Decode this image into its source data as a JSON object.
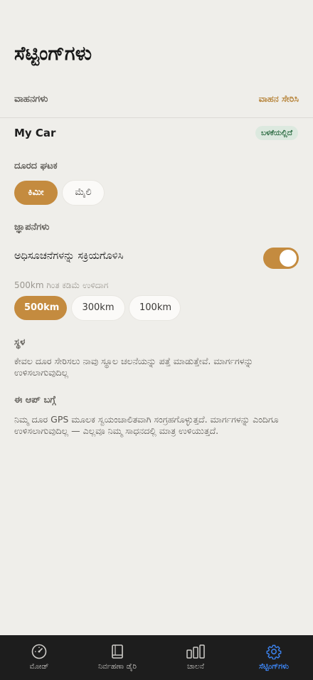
{
  "header": {
    "title": "ಸೆಟ್ಟಿಂಗ್‌ಗಳು"
  },
  "vehicles": {
    "label": "ವಾಹನಗಳು",
    "add_label": "ವಾಹನ ಸೇರಿಸಿ",
    "items": [
      {
        "name": "My Car",
        "badge": "ಬಳಕೆಯಲ್ಲಿದೆ"
      }
    ]
  },
  "distance_unit": {
    "label": "ದೂರದ ಘಟಕ",
    "options": [
      {
        "label": "ಕಿಮೀ",
        "selected": true
      },
      {
        "label": "ಮೈಲಿ",
        "selected": false
      }
    ]
  },
  "reminders": {
    "label": "ಜ್ಞಾಪನೆಗಳು",
    "notifications_label": "ಅಧಿಸೂಚನೆಗಳನ್ನು ಸಕ್ರಿಯಗೊಳಿಸಿ",
    "notifications_enabled": true,
    "threshold_label": "500km ಗಿಂತ ಕಡಿಮೆ ಉಳಿದಾಗ",
    "thresholds": [
      {
        "label": "500km",
        "selected": true
      },
      {
        "label": "300km",
        "selected": false
      },
      {
        "label": "100km",
        "selected": false
      }
    ]
  },
  "location": {
    "label": "ಸ್ಥಳ",
    "description": "ಕೇವಲ ದೂರ ಸೇರಿಸಲು ನಾವು ಸ್ಥೂಲ ಚಲನೆಯನ್ನು ಪತ್ತೆ ಮಾಡುತ್ತೇವೆ. ಮಾರ್ಗಗಳನ್ನು ಉಳಿಸಲಾಗುವುದಿಲ್ಲ"
  },
  "about": {
    "label": "ಈ ಆಪ್ ಬಗ್ಗೆ",
    "description": "ನಿಮ್ಮ ದೂರ GPS ಮೂಲಕ ಸ್ವಯಂಚಾಲಿತವಾಗಿ ಸಂಗ್ರಹಗೊಳ್ಳುತ್ತದೆ. ಮಾರ್ಗಗಳನ್ನು ಎಂದಿಗೂ ಉಳಿಸಲಾಗುವುದಿಲ್ಲ — ಎಲ್ಲವೂ ನಿಮ್ಮ ಸಾಧನದಲ್ಲಿ ಮಾತ್ರ ಉಳಿಯುತ್ತದೆ."
  },
  "tabbar": {
    "tabs": [
      {
        "label": "ಮೋಡ್",
        "icon": "gauge-icon",
        "active": false
      },
      {
        "label": "ನಿರ್ವಹಣಾ ಡೈರಿ",
        "icon": "book-icon",
        "active": false
      },
      {
        "label": "ಚಾಲನೆ",
        "icon": "bar-chart-icon",
        "active": false
      },
      {
        "label": "ಸೆಟ್ಟಿಂಗ್‌ಗಳು",
        "icon": "gear-icon",
        "active": true
      }
    ]
  },
  "colors": {
    "accent": "#c48b3f",
    "active_tab": "#3d86f5",
    "badge_bg": "#dce9df",
    "badge_text": "#2f6e45"
  }
}
